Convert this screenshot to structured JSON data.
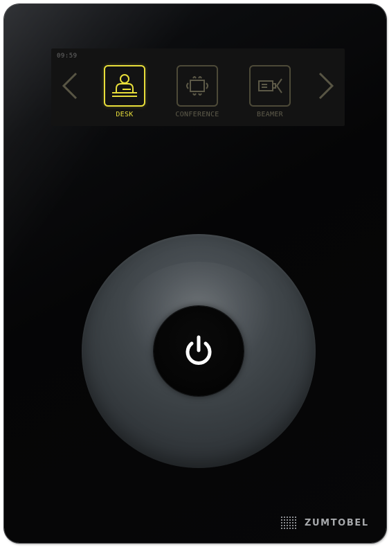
{
  "display": {
    "clock": "09:59",
    "modes": [
      {
        "label": "DESK",
        "icon": "desk-icon",
        "active": true
      },
      {
        "label": "CONFERENCE",
        "icon": "conference-table-icon",
        "active": false
      },
      {
        "label": "BEAMER",
        "icon": "projector-icon",
        "active": false
      }
    ],
    "nav": {
      "prev_icon": "chevron-left-icon",
      "next_icon": "chevron-right-icon"
    }
  },
  "controls": {
    "power_icon": "power-icon"
  },
  "brand": {
    "name": "ZUMTOBEL"
  },
  "colors": {
    "accent": "#e8de3a",
    "inactive": "#4d4a38",
    "panel_bg": "#050506",
    "dial": "#3d4347"
  }
}
